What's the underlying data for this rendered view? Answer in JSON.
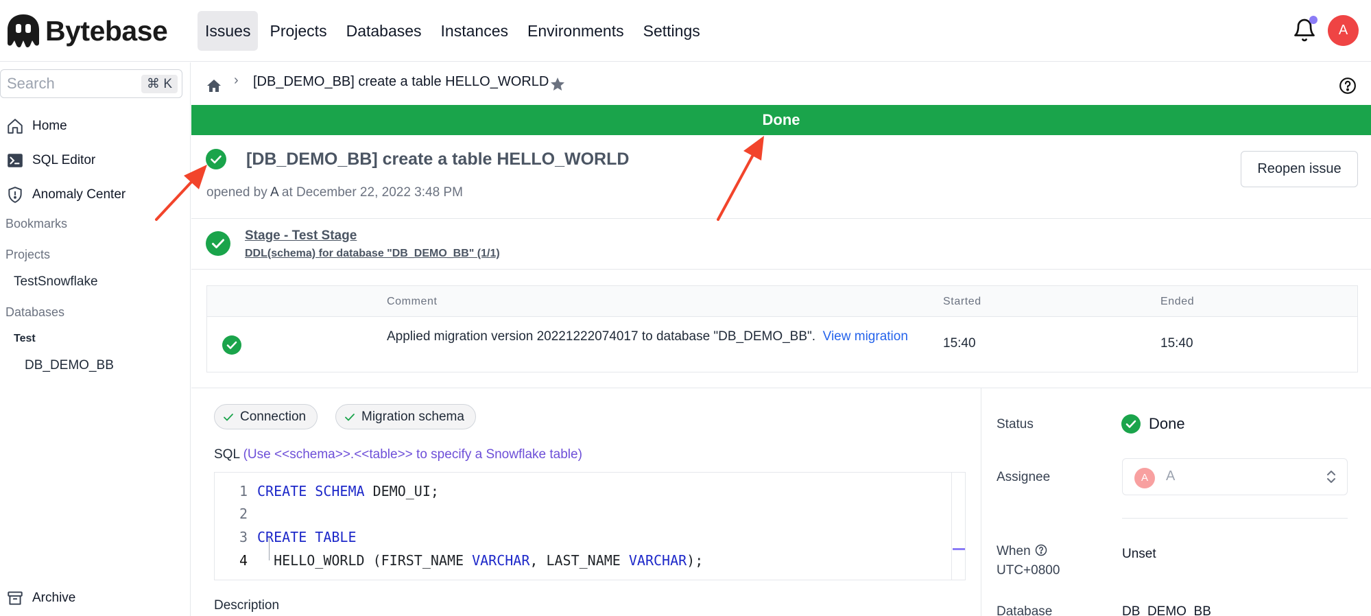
{
  "brand": {
    "name": "Bytebase"
  },
  "nav": {
    "items": [
      {
        "label": "Issues",
        "active": true
      },
      {
        "label": "Projects",
        "active": false
      },
      {
        "label": "Databases",
        "active": false
      },
      {
        "label": "Instances",
        "active": false
      },
      {
        "label": "Environments",
        "active": false
      },
      {
        "label": "Settings",
        "active": false
      }
    ],
    "user_initial": "A"
  },
  "sidebar": {
    "search_placeholder": "Search",
    "search_shortcut": "⌘ K",
    "items": [
      {
        "label": "Home",
        "icon": "home-icon"
      },
      {
        "label": "SQL Editor",
        "icon": "terminal-icon"
      },
      {
        "label": "Anomaly Center",
        "icon": "shield-icon"
      }
    ],
    "bookmarks_label": "Bookmarks",
    "projects_label": "Projects",
    "projects": [
      "TestSnowflake"
    ],
    "databases_label": "Databases",
    "db_env": "Test",
    "databases": [
      "DB_DEMO_BB"
    ],
    "archive_label": "Archive"
  },
  "breadcrumb": {
    "title": "[DB_DEMO_BB] create a table HELLO_WORLD",
    "separator": "›"
  },
  "status_bar": {
    "label": "Done",
    "color": "#1aa44b"
  },
  "issue": {
    "title": "[DB_DEMO_BB] create a table HELLO_WORLD",
    "opened_prefix": "opened by",
    "opened_by": "A",
    "opened_at": "at December 22, 2022 3:48 PM",
    "reopen_label": "Reopen issue"
  },
  "stage": {
    "name": "Stage - Test Stage",
    "task": "DDL(schema) for database \"DB_DEMO_BB\" (1/1)"
  },
  "task_table": {
    "columns": [
      "Comment",
      "Started",
      "Ended"
    ],
    "rows": [
      {
        "comment": "Applied migration version 20221222074017 to database \"DB_DEMO_BB\".",
        "link_view": "View",
        "link_migration": "migration",
        "started": "15:40",
        "ended": "15:40"
      }
    ]
  },
  "checks": [
    {
      "label": "Connection"
    },
    {
      "label": "Migration schema"
    }
  ],
  "sql": {
    "label": "SQL",
    "hint": "(Use <<schema>>.<<table>> to specify a Snowflake table)",
    "lines": [
      {
        "n": "1",
        "kw1": "CREATE SCHEMA",
        "rest": " DEMO_UI;"
      },
      {
        "n": "2"
      },
      {
        "n": "3",
        "kw1": "CREATE TABLE"
      },
      {
        "n": "4",
        "p1": "  HELLO_WORLD (FIRST_NAME ",
        "k1": "VARCHAR",
        "p2": ", LAST_NAME ",
        "k2": "VARCHAR",
        "p3": ");"
      }
    ]
  },
  "description_label": "Description",
  "details": {
    "status_label": "Status",
    "status_value": "Done",
    "assignee_label": "Assignee",
    "assignee_initial": "A",
    "assignee_name": "A",
    "when_label": "When",
    "timezone": "UTC+0800",
    "when_value": "Unset",
    "database_label": "Database",
    "database_value": "DB_DEMO_BB"
  },
  "colors": {
    "success": "#1aa44b",
    "link": "#2563eb",
    "accent": "#8b7cf6",
    "annotation": "#f2442b"
  }
}
